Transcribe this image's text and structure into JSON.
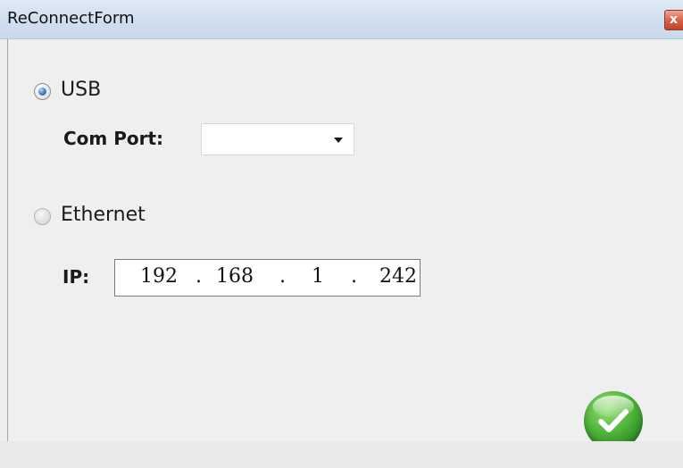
{
  "window": {
    "title": "ReConnectForm",
    "close_glyph": "x"
  },
  "usb": {
    "label": "USB",
    "selected": true,
    "com_port_label": "Com Port:",
    "com_port_value": ""
  },
  "ethernet": {
    "label": "Ethernet",
    "selected": false,
    "ip_label": "IP:",
    "ip": [
      "192",
      "168",
      "1",
      "242"
    ],
    "separator": "."
  },
  "footer": {
    "ok_icon": "checkmark-icon"
  }
}
